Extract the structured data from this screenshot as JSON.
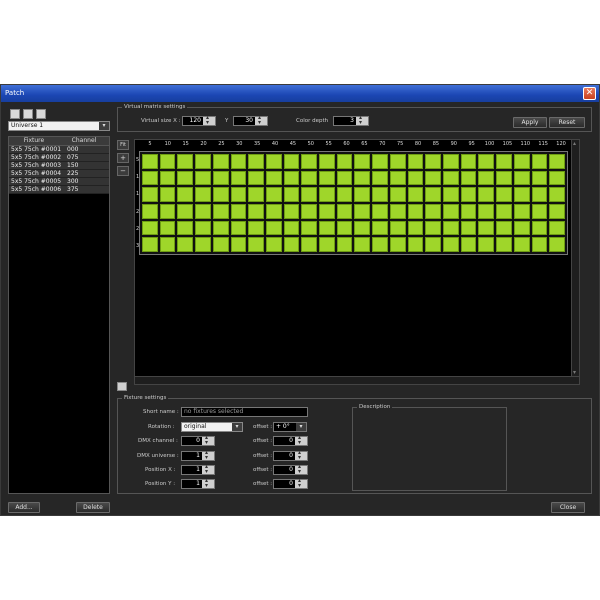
{
  "window": {
    "title": "Patch"
  },
  "left_panel": {
    "universe": "Universe 1",
    "columns": [
      "Fixture",
      "Channel"
    ],
    "fixtures": [
      {
        "name": "5x5 75ch #0001",
        "channel": "000"
      },
      {
        "name": "5x5 75ch #0002",
        "channel": "075"
      },
      {
        "name": "5x5 75ch #0003",
        "channel": "150"
      },
      {
        "name": "5x5 75ch #0004",
        "channel": "225"
      },
      {
        "name": "5x5 75ch #0005",
        "channel": "300"
      },
      {
        "name": "5x5 75ch #0006",
        "channel": "375"
      }
    ],
    "add_label": "Add...",
    "delete_label": "Delete"
  },
  "matrix_settings": {
    "group_title": "Virtual matrix settings",
    "size_x_label": "Virtual size X :",
    "size_x": "120",
    "y_label": "Y",
    "size_y": "30",
    "color_depth_label": "Color depth",
    "color_depth": "3",
    "apply_label": "Apply",
    "reset_label": "Reset"
  },
  "matrix": {
    "fit_label": "Fit",
    "zoom_in": "+",
    "zoom_out": "−",
    "x_ticks": [
      "5",
      "10",
      "15",
      "20",
      "25",
      "30",
      "35",
      "40",
      "45",
      "50",
      "55",
      "60",
      "65",
      "70",
      "75",
      "80",
      "85",
      "90",
      "95",
      "100",
      "105",
      "110",
      "115",
      "120"
    ],
    "y_ticks": [
      "5",
      "10",
      "15",
      "20",
      "25",
      "30"
    ],
    "cols": 24,
    "rows": 6
  },
  "fixture_settings": {
    "group_title": "Fixture settings",
    "short_name_label": "Short name :",
    "short_name_placeholder": "no fixtures selected",
    "rotation_label": "Rotation :",
    "rotation_value": "original",
    "offset_label": "offset :",
    "rotation_offset": "+ 0°",
    "dmx_channel_label": "DMX channel :",
    "dmx_channel": "0",
    "dmx_channel_offset": "0",
    "dmx_universe_label": "DMX universe :",
    "dmx_universe": "1",
    "dmx_universe_offset": "0",
    "position_x_label": "Position X :",
    "position_x": "1",
    "position_x_offset": "0",
    "position_y_label": "Position Y :",
    "position_y": "1",
    "position_y_offset": "0",
    "description_title": "Description"
  },
  "footer": {
    "close_label": "Close"
  }
}
